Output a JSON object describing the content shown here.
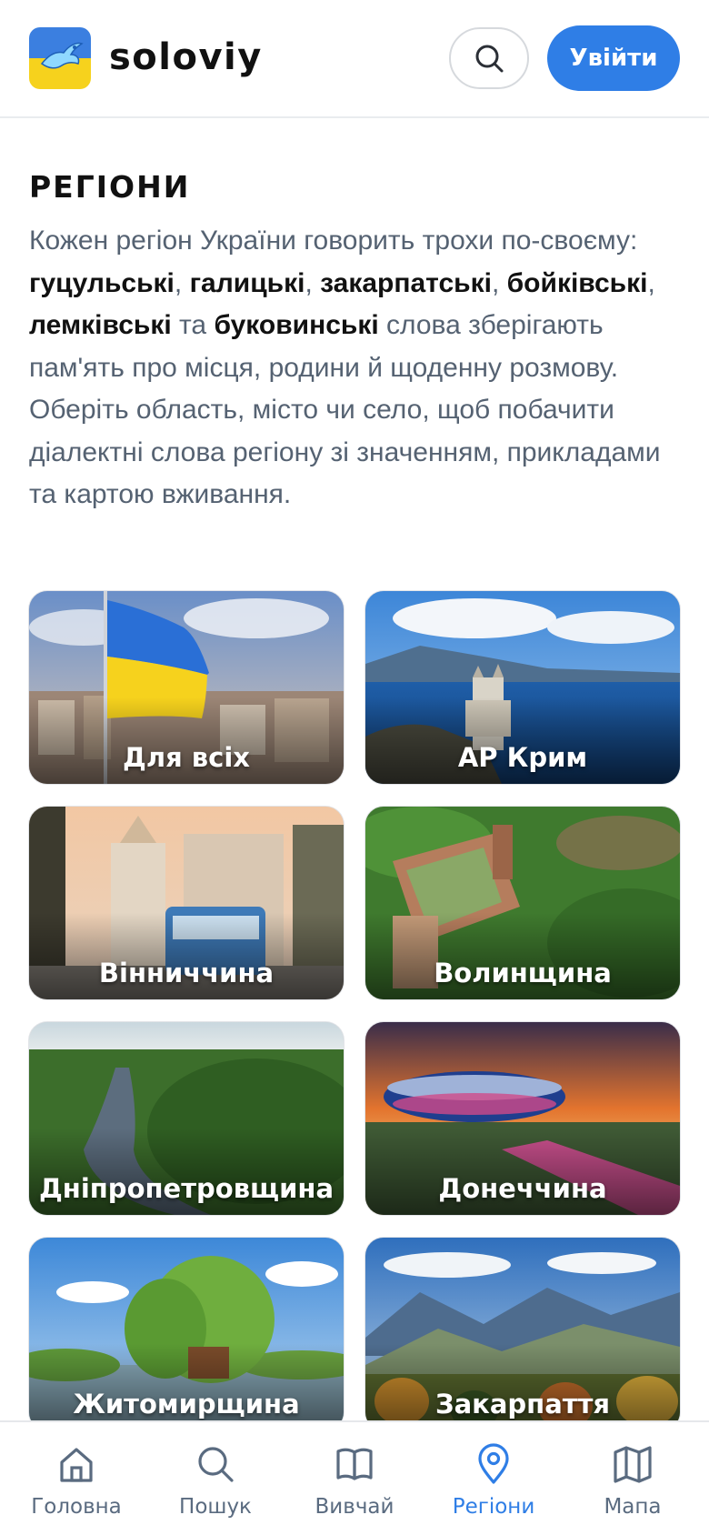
{
  "header": {
    "brand": "soloviy",
    "login_label": "Увійти",
    "logo_icon": "nightingale-logo-icon",
    "search_icon": "search-icon"
  },
  "intro": {
    "title": "РЕГІОНИ",
    "p1": "Кожен регіон України говорить трохи по-своєму: ",
    "d1": "гуцульські",
    "sep1": ", ",
    "d2": "галицькі",
    "sep2": ", ",
    "d3": "закарпатські",
    "sep3": ", ",
    "d4": "бойківські",
    "sep4": ", ",
    "d5": "лемківські",
    "sep5": " та ",
    "d6": "буковинські",
    "p2": " слова зберігають пам'ять про місця, родини й щоденну розмову. Оберіть область, місто чи село, щоб побачити діалектні слова регіону зі значенням, прикладами та картою вживання."
  },
  "regions": [
    {
      "label": "Для всіх"
    },
    {
      "label": "АР Крим"
    },
    {
      "label": "Вінниччина"
    },
    {
      "label": "Волинщина"
    },
    {
      "label": "Дніпропетровщина"
    },
    {
      "label": "Донеччина"
    },
    {
      "label": "Житомирщина"
    },
    {
      "label": "Закарпаття"
    }
  ],
  "nav": {
    "active": "Регіони",
    "items": [
      {
        "label": "Головна",
        "icon": "home-icon"
      },
      {
        "label": "Пошук",
        "icon": "search-icon"
      },
      {
        "label": "Вивчай",
        "icon": "book-icon"
      },
      {
        "label": "Регіони",
        "icon": "map-pin-icon"
      },
      {
        "label": "Мапа",
        "icon": "map-icon"
      }
    ]
  },
  "colors": {
    "accent": "#2f7ee6",
    "nav_inactive": "#5a6b80",
    "flag_blue": "#2a6fd6",
    "flag_yellow": "#f6d21d"
  }
}
